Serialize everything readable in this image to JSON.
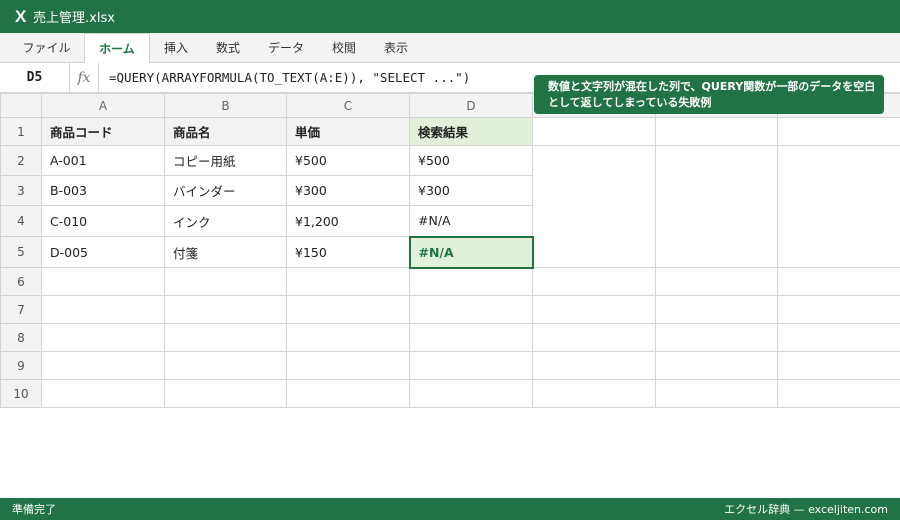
{
  "app": {
    "logo": "X",
    "file_name": "売上管理.xlsx"
  },
  "ribbon": {
    "tabs": [
      {
        "label": "ファイル"
      },
      {
        "label": "ホーム",
        "active": true
      },
      {
        "label": "挿入"
      },
      {
        "label": "数式"
      },
      {
        "label": "データ"
      },
      {
        "label": "校閲"
      },
      {
        "label": "表示"
      }
    ]
  },
  "formula_bar": {
    "cell_ref": "D5",
    "fx_label": "fx",
    "formula": "=QUERY(ARRAYFORMULA(TO_TEXT(A:E)), \"SELECT ...\")"
  },
  "callout": {
    "text": "数値と文字列が混在した列で、QUERY関数が一部のデータを空白として返してしまっている失敗例"
  },
  "sheet": {
    "columns": [
      "A",
      "B",
      "C",
      "D",
      "",
      "",
      ""
    ],
    "rows": [
      {
        "num": "1",
        "cells": [
          "商品コード",
          "商品名",
          "単価",
          "検索結果"
        ]
      },
      {
        "num": "2",
        "cells": [
          "A-001",
          "コピー用紙",
          "¥500",
          "¥500"
        ]
      },
      {
        "num": "3",
        "cells": [
          "B-003",
          "バインダー",
          "¥300",
          "¥300"
        ]
      },
      {
        "num": "4",
        "cells": [
          "C-010",
          "インク",
          "¥1,200",
          "#N/A"
        ]
      },
      {
        "num": "5",
        "cells": [
          "D-005",
          "付箋",
          "¥150",
          "#N/A"
        ]
      },
      {
        "num": "6",
        "cells": []
      },
      {
        "num": "7",
        "cells": []
      },
      {
        "num": "8",
        "cells": []
      },
      {
        "num": "9",
        "cells": []
      },
      {
        "num": "10",
        "cells": []
      }
    ]
  },
  "status_bar": {
    "left": "準備完了",
    "right": "エクセル辞典 — exceljiten.com"
  },
  "colors": {
    "accent": "#217346",
    "result_fill": "#e2efda",
    "header_fill": "#f2f2f2",
    "grid_line": "#d4d4d4"
  }
}
